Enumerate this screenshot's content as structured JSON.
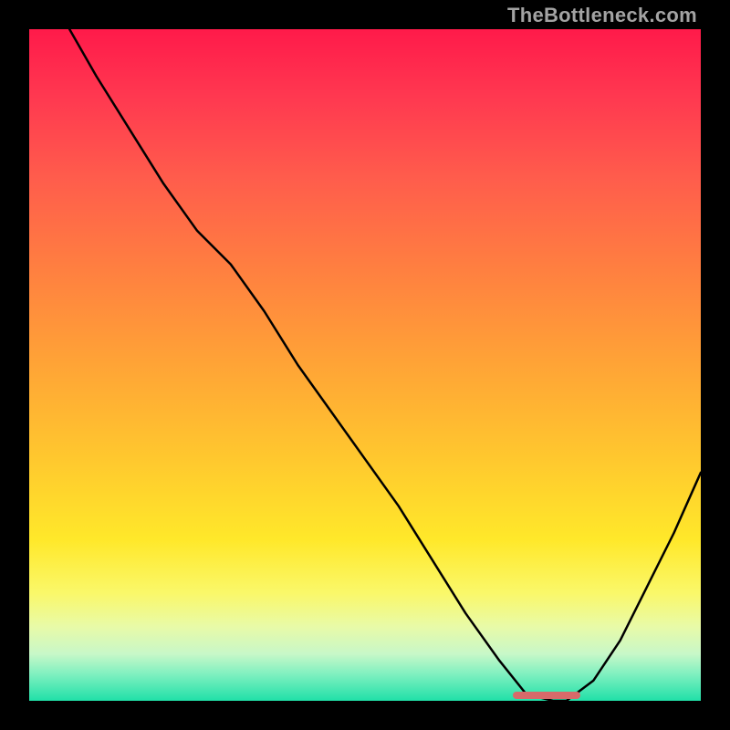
{
  "watermark": "TheBottleneck.com",
  "colors": {
    "background": "#000000",
    "curve_stroke": "#000000",
    "marker": "#d76a6a",
    "gradient_top": "#ff1a4a",
    "gradient_bottom": "#20e0a8"
  },
  "chart_data": {
    "type": "line",
    "title": "",
    "xlabel": "",
    "ylabel": "",
    "xlim": [
      0,
      100
    ],
    "ylim": [
      0,
      100
    ],
    "grid": false,
    "series": [
      {
        "name": "bottleneck-curve",
        "x": [
          6,
          10,
          15,
          20,
          25,
          30,
          35,
          40,
          45,
          50,
          55,
          60,
          65,
          70,
          74,
          78,
          80,
          84,
          88,
          92,
          96,
          100
        ],
        "y": [
          100,
          93,
          85,
          77,
          70,
          65,
          58,
          50,
          43,
          36,
          29,
          21,
          13,
          6,
          1,
          0,
          0,
          3,
          9,
          17,
          25,
          34
        ]
      }
    ],
    "annotations": [
      {
        "name": "optimal-range-marker",
        "x_start": 72,
        "x_end": 82,
        "y": 0
      }
    ]
  }
}
